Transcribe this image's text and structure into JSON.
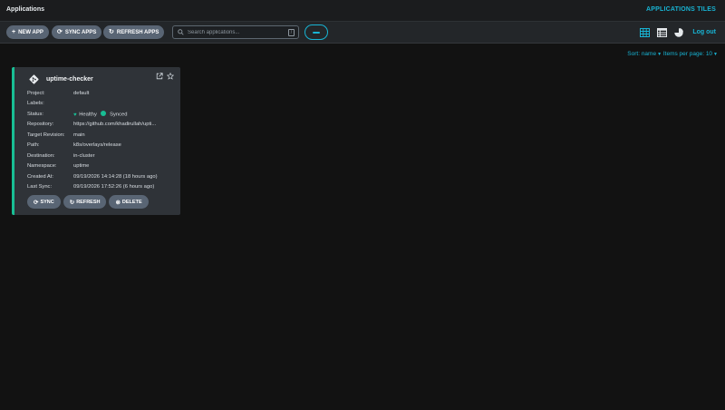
{
  "header": {
    "title": "Applications",
    "view_label": "APPLICATIONS TILES"
  },
  "toolbar": {
    "new_app": "NEW APP",
    "sync_apps": "SYNC APPS",
    "refresh_apps": "REFRESH APPS",
    "search_placeholder": "Search applications...",
    "search_shortcut": "/",
    "logout": "Log out",
    "view_icons": [
      "tiles-view-icon",
      "list-view-icon",
      "summary-pie-icon"
    ]
  },
  "sort": {
    "label": "Sort: name",
    "per_page": "Items per page: 10"
  },
  "app_card": {
    "name": "uptime-checker",
    "fields": [
      {
        "key": "Project:",
        "value": "default"
      },
      {
        "key": "Labels:",
        "value": ""
      },
      {
        "key": "Status:",
        "health": "Healthy",
        "sync": "Synced"
      },
      {
        "key": "Repository:",
        "value": "https://github.com/khadirullah/upti..."
      },
      {
        "key": "Target Revision:",
        "value": "main"
      },
      {
        "key": "Path:",
        "value": "k8s/overlays/release"
      },
      {
        "key": "Destination:",
        "value": "in-cluster"
      },
      {
        "key": "Namespace:",
        "value": "uptime"
      },
      {
        "key": "Created At:",
        "value": "09/19/2026 14:14:28  (18 hours ago)"
      },
      {
        "key": "Last Sync:",
        "value": "09/19/2026 17:52:26  (6 hours ago)"
      }
    ],
    "buttons": {
      "sync": "SYNC",
      "refresh": "REFRESH",
      "delete": "DELETE"
    }
  },
  "colors": {
    "accent": "#18b4d4",
    "healthy": "#18be94",
    "button": "#596574"
  }
}
